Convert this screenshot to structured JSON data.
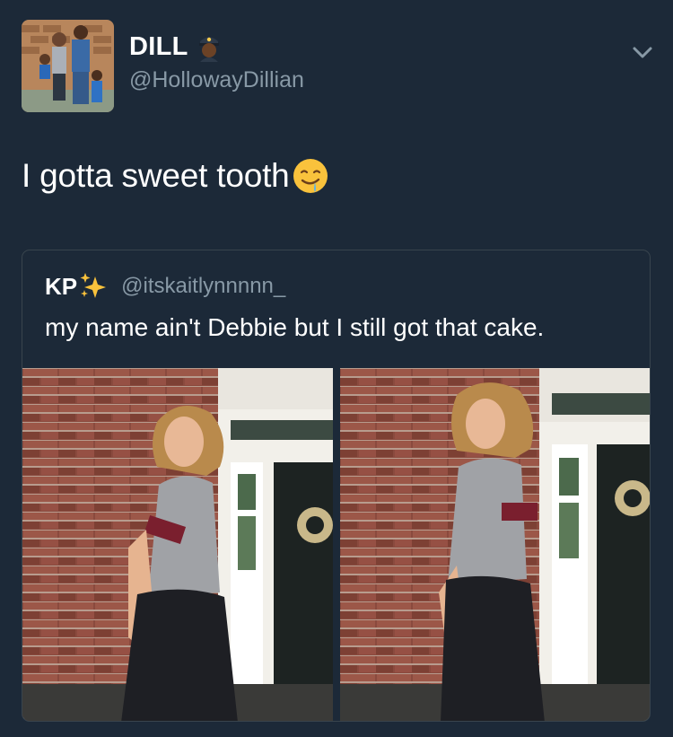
{
  "author": {
    "name": "DILL",
    "handle": "@HollowayDillian",
    "emoji_icon": "police-officer-emoji-icon"
  },
  "tweet": {
    "text": "I gotta sweet tooth",
    "emoji_icon": "drooling-face-emoji-icon"
  },
  "quoted": {
    "name": "KP",
    "name_emoji_icon": "sparkles-emoji-icon",
    "handle": "@itskaitlynnnnn_",
    "text": "my name ain't Debbie but I still got that cake."
  },
  "colors": {
    "background": "#1c2938",
    "border": "#38444d",
    "secondary_text": "#8899a6",
    "primary_text": "#ffffff"
  }
}
